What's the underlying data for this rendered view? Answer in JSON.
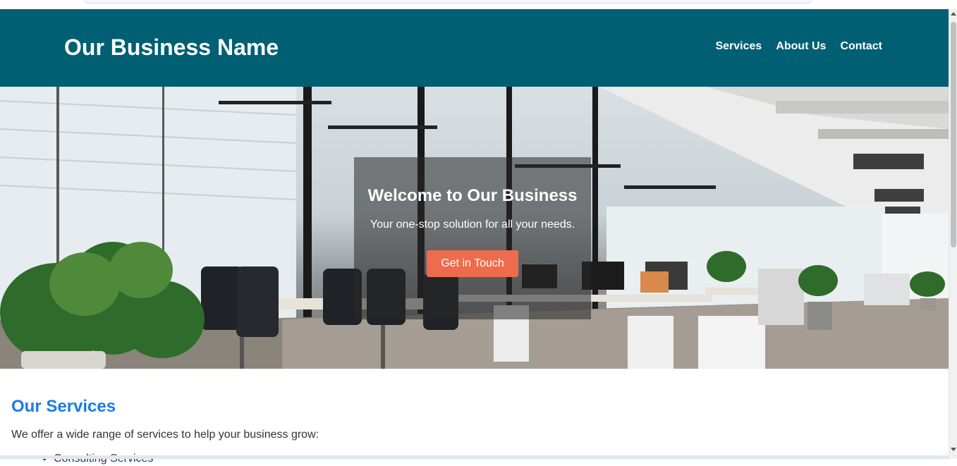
{
  "header": {
    "title": "Our Business Name",
    "nav": [
      "Services",
      "About Us",
      "Contact"
    ]
  },
  "hero": {
    "title": "Welcome to Our Business",
    "subtitle": "Your one-stop solution for all your needs.",
    "button_label": "Get in Touch",
    "image_description_icon": "office-interior-photo"
  },
  "services": {
    "title": "Our Services",
    "intro": "We offer a wide range of services to help your business grow:",
    "items": [
      "Consulting Services"
    ]
  },
  "colors": {
    "header_bg": "#005f73",
    "button_bg": "#ee6c4d",
    "services_title": "#1a7be8"
  }
}
